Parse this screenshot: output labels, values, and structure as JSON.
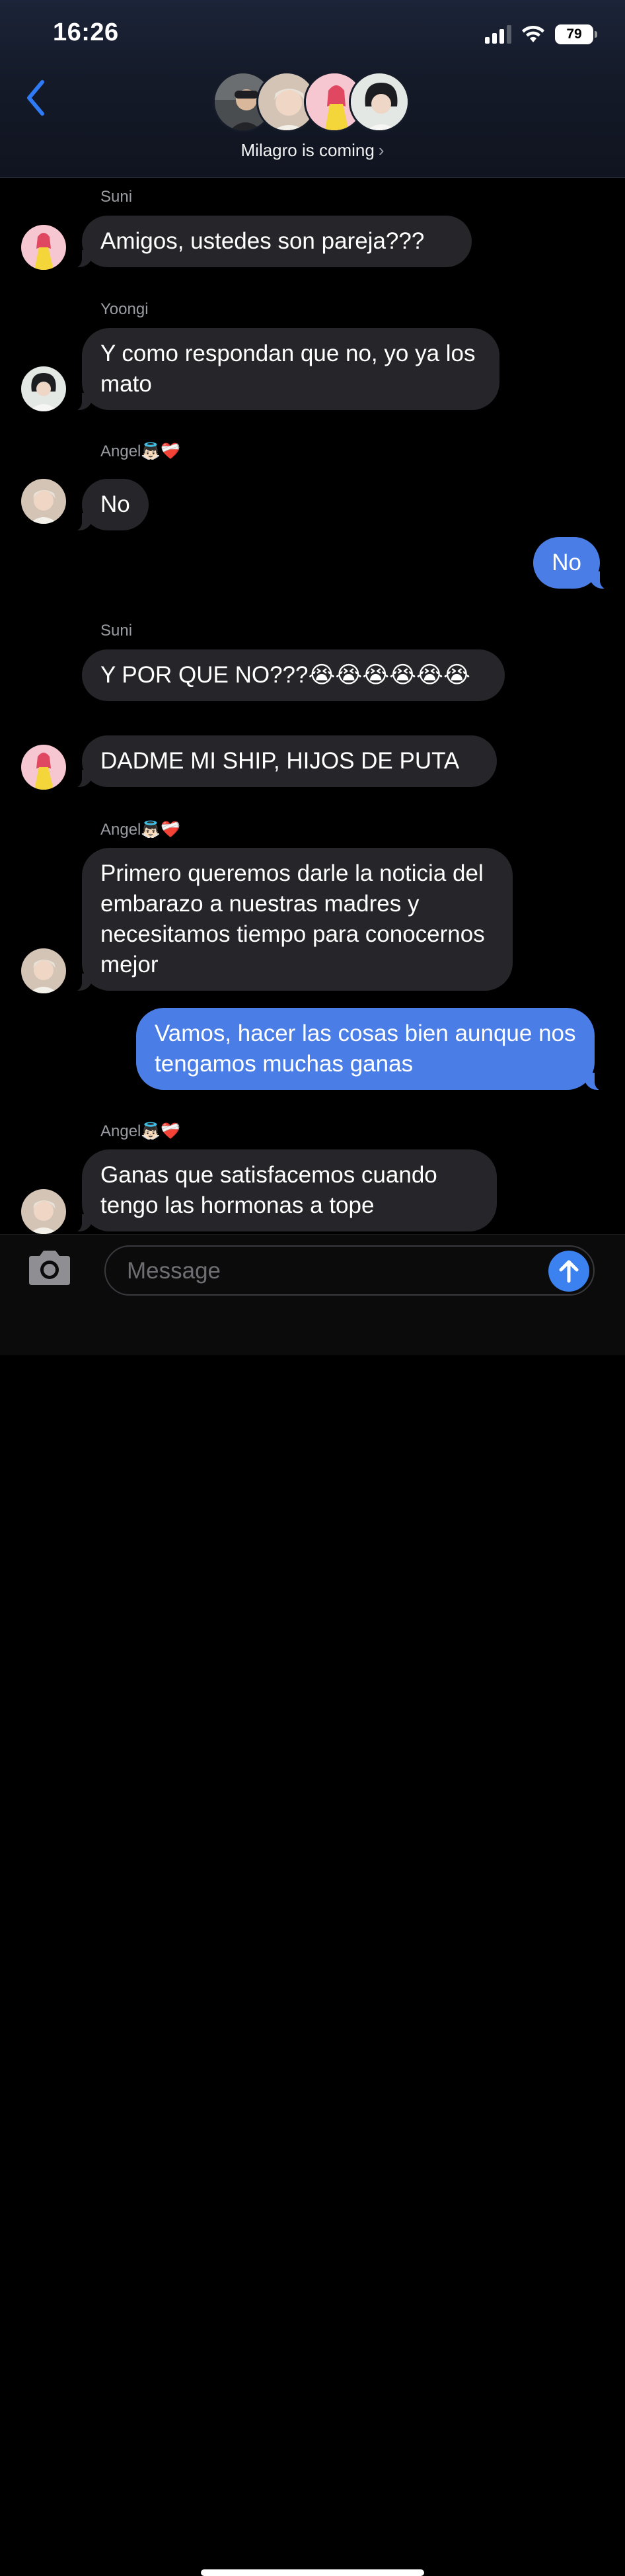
{
  "status_bar": {
    "time": "16:26",
    "battery": "79",
    "icons": [
      "signal-icon",
      "wifi-icon",
      "battery-icon"
    ]
  },
  "header": {
    "back_icon": "chevron-left-icon",
    "group_name": "Milagro is coming",
    "group_chevron": "›",
    "accent_color": "#2f7bf5"
  },
  "messages": [
    {
      "sender": "Suni",
      "text": "Amigos, ustedes son pareja???",
      "direction": "incoming"
    },
    {
      "sender": "Yoongi",
      "text": "Y como respondan que no, yo ya los mato",
      "direction": "incoming"
    },
    {
      "sender": "Angel👼🏻❤️‍🩹",
      "text": "No",
      "direction": "incoming"
    },
    {
      "sender": "",
      "text": "No",
      "direction": "outgoing"
    },
    {
      "sender": "Suni",
      "text": "Y POR QUE NO???😭😭😭😭😭😭",
      "direction": "incoming"
    },
    {
      "sender": "",
      "text": "DADME MI SHIP, HIJOS DE PUTA",
      "direction": "incoming"
    },
    {
      "sender": "Angel👼🏻❤️‍🩹",
      "text": "Primero queremos darle la noticia del embarazo a nuestras madres y necesitamos tiempo para conocernos mejor",
      "direction": "incoming"
    },
    {
      "sender": "",
      "text": "Vamos, hacer las cosas bien aunque nos tengamos muchas ganas",
      "direction": "outgoing"
    },
    {
      "sender": "Angel👼🏻❤️‍🩹",
      "text": "Ganas que satisfacemos cuando tengo las hormonas a tope",
      "direction": "incoming"
    }
  ],
  "composer": {
    "camera_icon": "camera-icon",
    "placeholder": "Message",
    "value": "",
    "send_icon": "arrow-up-icon"
  },
  "colors": {
    "incoming_bubble": "#26262a",
    "outgoing_bubble": "#4a7ee6",
    "send_button": "#3b82f0",
    "background": "#000000"
  }
}
